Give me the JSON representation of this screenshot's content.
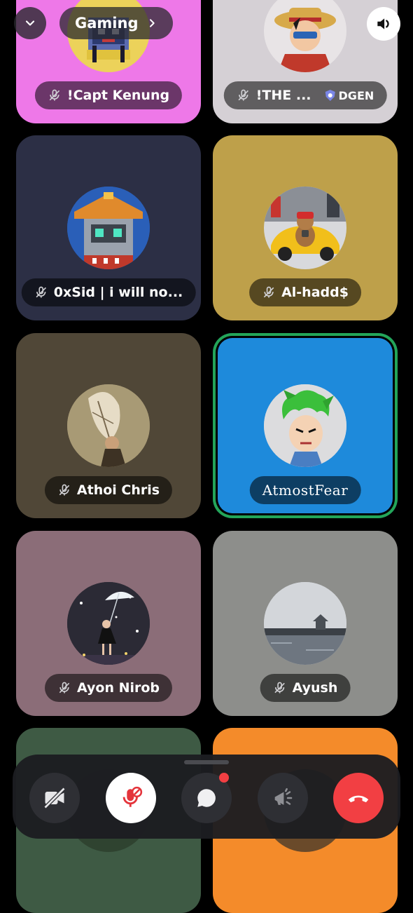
{
  "header": {
    "channel_name": "Gaming"
  },
  "participants": [
    {
      "name": "!Capt Kenung",
      "muted": true,
      "bg": "#ee78e8"
    },
    {
      "name": "!THE ...",
      "tag": "DGEN",
      "muted": true,
      "bg": "#d5d0d5"
    },
    {
      "name": "0xSid | i will no...",
      "muted": true,
      "bg": "#2c2f45"
    },
    {
      "name": "Al-hadd$",
      "muted": true,
      "bg": "#bea04a"
    },
    {
      "name": "Athoi Chris",
      "muted": true,
      "bg": "#504737"
    },
    {
      "name": "AtmostFear",
      "muted": false,
      "speaking": true,
      "bg": "#1e8adb"
    },
    {
      "name": "Ayon Nirob",
      "muted": true,
      "bg": "#8b6d78"
    },
    {
      "name": "Ayush",
      "muted": true,
      "bg": "#8d8e8b"
    },
    {
      "name": "",
      "bg": "#3e5a44"
    },
    {
      "name": "",
      "bg": "#f48b2a"
    }
  ],
  "controls": {
    "camera": {
      "icon": "camera-off-icon"
    },
    "microphone": {
      "icon": "mic-muted-icon"
    },
    "chat": {
      "icon": "chat-bubble-icon",
      "unread": true
    },
    "soundboard": {
      "icon": "soundboard-icon"
    },
    "leave": {
      "icon": "hang-up-icon",
      "color": "#f23f43"
    }
  }
}
